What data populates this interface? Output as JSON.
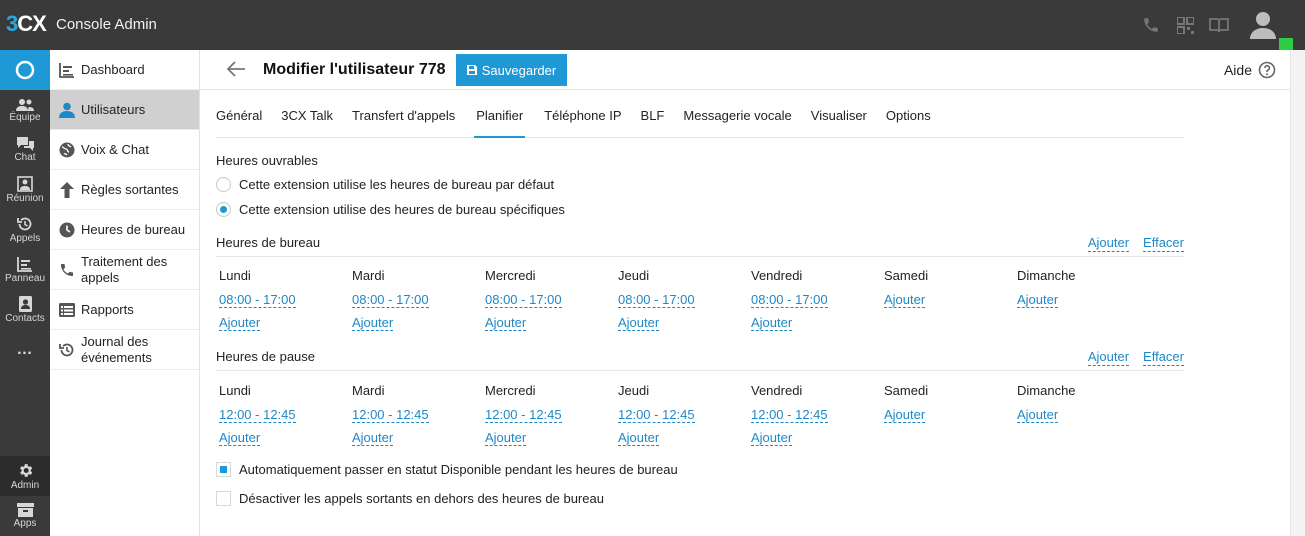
{
  "app": {
    "logo_3": "3",
    "logo_cx": "CX",
    "title": "Console Admin"
  },
  "topbar_icons": [
    "phone-icon",
    "qr-code-icon",
    "book-icon",
    "user-avatar-icon"
  ],
  "rail": {
    "items": [
      {
        "label": "Équipe",
        "icon": "team-icon"
      },
      {
        "label": "Chat",
        "icon": "chat-icon"
      },
      {
        "label": "Réunion",
        "icon": "meeting-icon"
      },
      {
        "label": "Appels",
        "icon": "calls-history-icon"
      },
      {
        "label": "Panneau",
        "icon": "panel-icon"
      },
      {
        "label": "Contacts",
        "icon": "contacts-icon"
      },
      {
        "label": "…",
        "icon": "more-icon"
      }
    ],
    "admin": "Admin",
    "apps": "Apps"
  },
  "sidebar": {
    "items": [
      {
        "label": "Dashboard",
        "icon": "dashboard-icon"
      },
      {
        "label": "Utilisateurs",
        "icon": "user-icon"
      },
      {
        "label": "Voix & Chat",
        "icon": "globe-icon"
      },
      {
        "label": "Règles sortantes",
        "icon": "arrow-up-icon"
      },
      {
        "label": "Heures de bureau",
        "icon": "clock-icon"
      },
      {
        "label": "Traitement des appels",
        "icon": "phone-icon"
      },
      {
        "label": "Rapports",
        "icon": "list-icon"
      },
      {
        "label": "Journal des événements",
        "icon": "history-icon"
      }
    ]
  },
  "header": {
    "title": "Modifier l'utilisateur 778",
    "save": "Sauvegarder",
    "help": "Aide"
  },
  "tabs": [
    "Général",
    "3CX Talk",
    "Transfert d'appels",
    "Planifier",
    "Téléphone IP",
    "BLF",
    "Messagerie vocale",
    "Visualiser",
    "Options"
  ],
  "schedule": {
    "business_hours_title": "Heures ouvrables",
    "radio_default": "Cette extension utilise les heures de bureau par défaut",
    "radio_specific": "Cette extension utilise des heures de bureau spécifiques",
    "office_hours": {
      "title": "Heures de bureau",
      "add": "Ajouter",
      "clear": "Effacer",
      "days": [
        {
          "name": "Lundi",
          "range": "08:00 - 17:00",
          "add": "Ajouter"
        },
        {
          "name": "Mardi",
          "range": "08:00 - 17:00",
          "add": "Ajouter"
        },
        {
          "name": "Mercredi",
          "range": "08:00 - 17:00",
          "add": "Ajouter"
        },
        {
          "name": "Jeudi",
          "range": "08:00 - 17:00",
          "add": "Ajouter"
        },
        {
          "name": "Vendredi",
          "range": "08:00 - 17:00",
          "add": "Ajouter"
        },
        {
          "name": "Samedi",
          "range": "",
          "add": "Ajouter"
        },
        {
          "name": "Dimanche",
          "range": "",
          "add": "Ajouter"
        }
      ]
    },
    "break_hours": {
      "title": "Heures de pause",
      "add": "Ajouter",
      "clear": "Effacer",
      "days": [
        {
          "name": "Lundi",
          "range": "12:00 - 12:45",
          "add": "Ajouter"
        },
        {
          "name": "Mardi",
          "range": "12:00 - 12:45",
          "add": "Ajouter"
        },
        {
          "name": "Mercredi",
          "range": "12:00 - 12:45",
          "add": "Ajouter"
        },
        {
          "name": "Jeudi",
          "range": "12:00 - 12:45",
          "add": "Ajouter"
        },
        {
          "name": "Vendredi",
          "range": "12:00 - 12:45",
          "add": "Ajouter"
        },
        {
          "name": "Samedi",
          "range": "",
          "add": "Ajouter"
        },
        {
          "name": "Dimanche",
          "range": "",
          "add": "Ajouter"
        }
      ]
    },
    "auto_available": "Automatiquement passer en statut Disponible pendant les heures de bureau",
    "disable_outbound": "Désactiver les appels sortants en dehors des heures de bureau"
  },
  "colors": {
    "accent": "#1f98d6",
    "topbar": "#3a3a3a",
    "online": "#2ecc40"
  }
}
